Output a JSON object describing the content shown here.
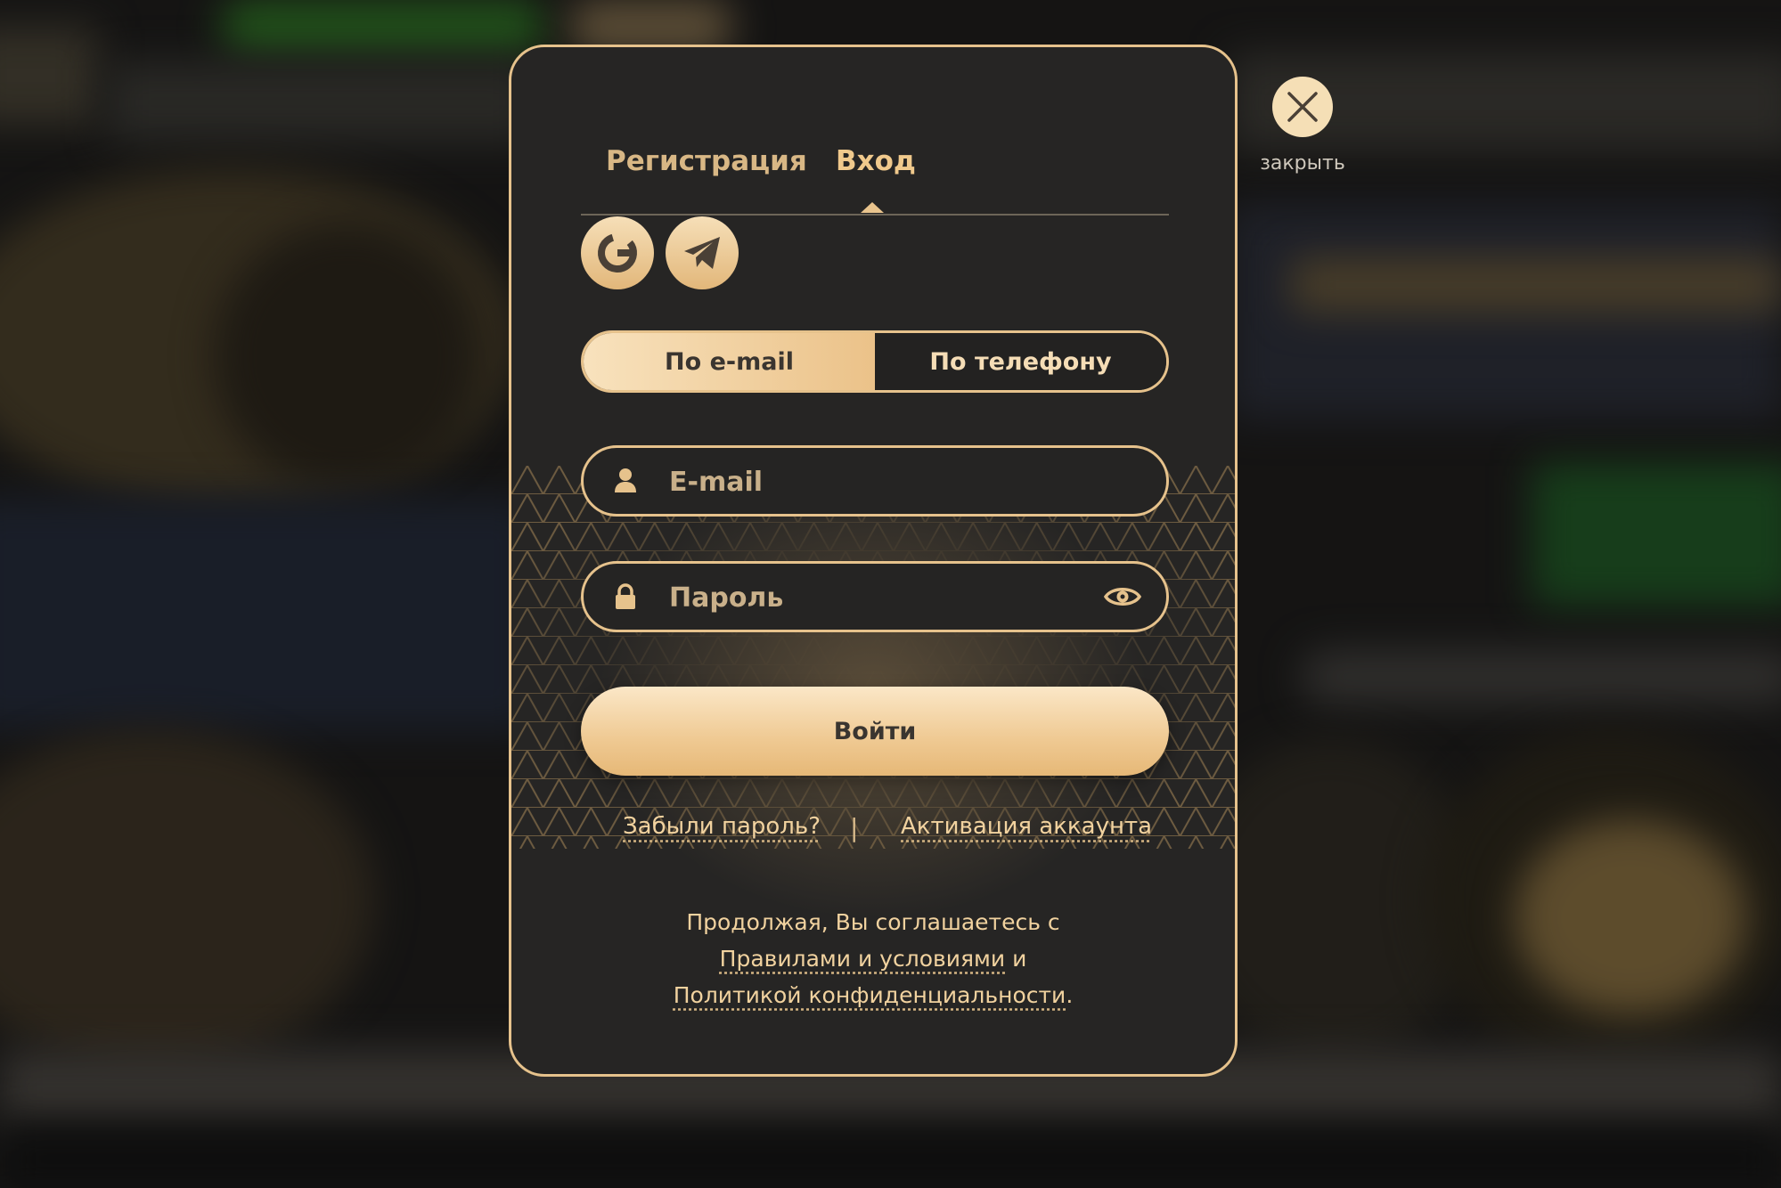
{
  "tabs": [
    {
      "label": "Регистрация",
      "active": false
    },
    {
      "label": "Вход",
      "active": true
    }
  ],
  "social": [
    {
      "icon": "google-icon"
    },
    {
      "icon": "telegram-icon"
    }
  ],
  "login_method": {
    "options": [
      "По e-mail",
      "По телефону"
    ],
    "selected": "По e-mail"
  },
  "fields": {
    "email": {
      "placeholder": "E-mail",
      "icon": "user-icon"
    },
    "password": {
      "placeholder": "Пароль",
      "icon": "lock-icon",
      "toggle_icon": "eye-icon"
    }
  },
  "submit_label": "Войти",
  "links": {
    "forgot": "Забыли пароль?",
    "separator": "|",
    "activate": "Активация аккаунта"
  },
  "terms": {
    "prefix": "Продолжая, Вы соглашаетесь с",
    "rules_link": "Правилами и условиями",
    "conjunction": "и",
    "privacy_link": "Политикой конфиденциальности",
    "suffix": "."
  },
  "close": {
    "label": "закрыть",
    "icon": "close-icon"
  },
  "colors": {
    "accent": "#e6c28c",
    "panel": "#262524",
    "text_gold": "#f1d29f",
    "button_dark_text": "#3a3530"
  }
}
